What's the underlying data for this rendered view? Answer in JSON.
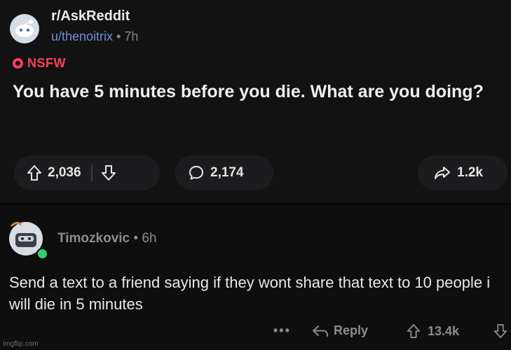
{
  "post": {
    "subreddit": "r/AskReddit",
    "username": "u/thenoitrix",
    "time_sep": "•",
    "time": "7h",
    "nsfw_label": "NSFW",
    "title": "You have 5 minutes before you die. What are you doing?",
    "upvotes": "2,036",
    "comments": "2,174",
    "shares": "1.2k"
  },
  "comment": {
    "author": "Timozkovic",
    "time": "• 6h",
    "body": "Send a text to a friend saying if they wont share that text to 10 people i will die in 5 minutes",
    "more": "•••",
    "reply_label": "Reply",
    "score": "13.4k"
  },
  "watermark": "imgflip.com",
  "colors": {
    "nsfw": "#ff3d5c",
    "username": "#6f8fd6",
    "online": "#2fd36a"
  }
}
